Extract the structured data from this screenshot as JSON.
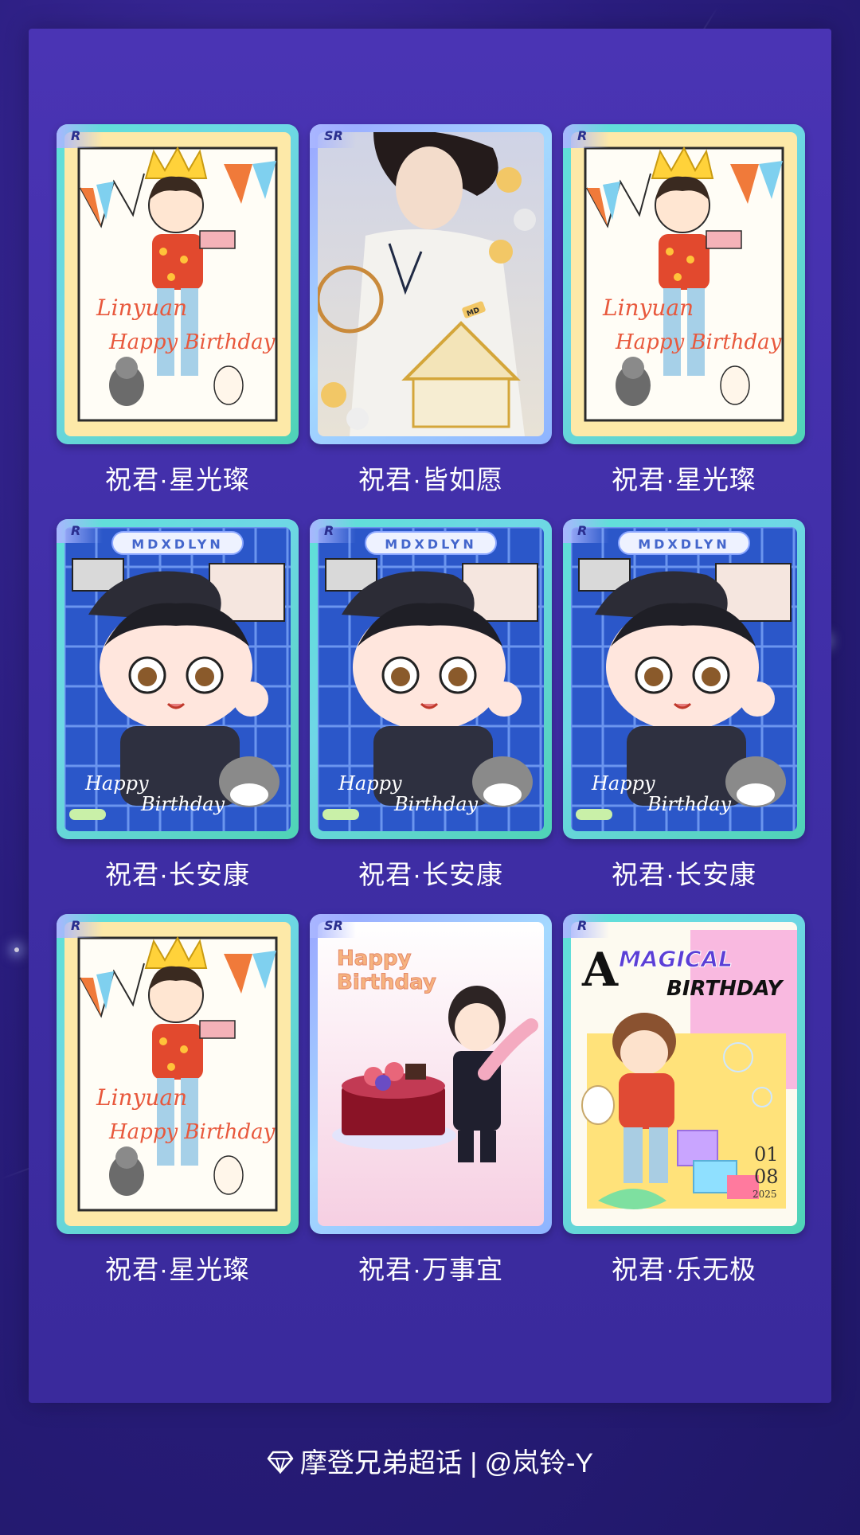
{
  "cards": [
    {
      "rarity": "R",
      "title": "祝君·星光璨",
      "art": "birthday-crown",
      "art_text": "Linyuan Happy Birthday"
    },
    {
      "rarity": "SR",
      "title": "祝君·皆如愿",
      "art": "carousel-portrait",
      "art_text": "MD"
    },
    {
      "rarity": "R",
      "title": "祝君·星光璨",
      "art": "birthday-crown",
      "art_text": "Linyuan Happy Birthday"
    },
    {
      "rarity": "R",
      "title": "祝君·长安康",
      "art": "plaid-chibi",
      "art_text": "MDXDLYN",
      "art_text2": "Happy Birthday"
    },
    {
      "rarity": "R",
      "title": "祝君·长安康",
      "art": "plaid-chibi",
      "art_text": "MDXDLYN",
      "art_text2": "Happy Birthday"
    },
    {
      "rarity": "R",
      "title": "祝君·长安康",
      "art": "plaid-chibi",
      "art_text": "MDXDLYN",
      "art_text2": "Happy Birthday"
    },
    {
      "rarity": "R",
      "title": "祝君·星光璨",
      "art": "birthday-crown",
      "art_text": "Linyuan Happy Birthday"
    },
    {
      "rarity": "SR",
      "title": "祝君·万事宜",
      "art": "cake-chef",
      "art_text": "Happy Birthday"
    },
    {
      "rarity": "R",
      "title": "祝君·乐无极",
      "art": "magical-birthday",
      "art_text": "A MAGICAL BIRTHDAY",
      "art_text2": "01 08 2025"
    }
  ],
  "footer": {
    "icon": "diamond-icon",
    "text": "摩登兄弟超话 | @岚铃-Y"
  }
}
